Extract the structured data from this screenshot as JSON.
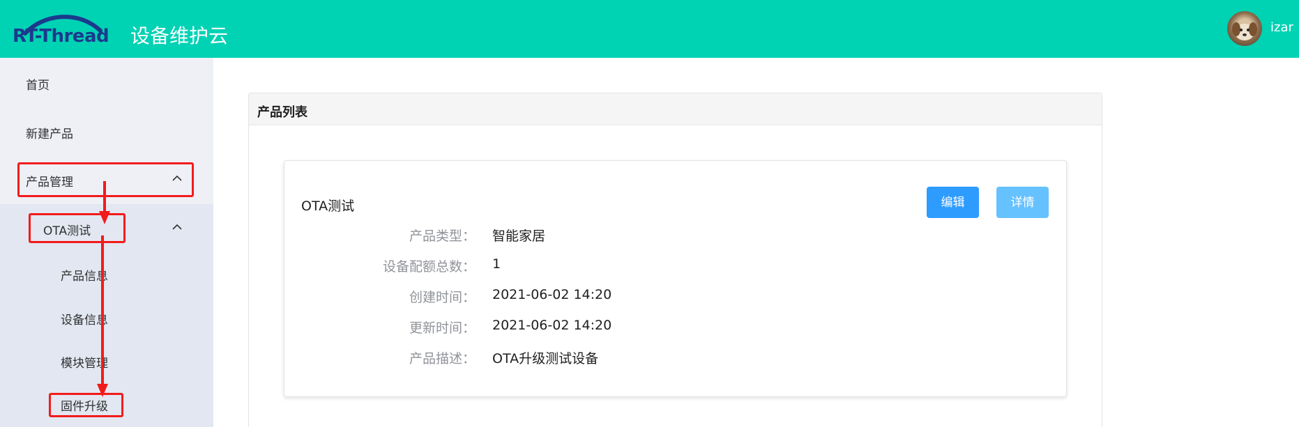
{
  "header": {
    "logo_text": "RT-Thread",
    "app_title": "设备维护云",
    "username": "izar"
  },
  "sidebar": {
    "items": [
      {
        "label": "首页"
      },
      {
        "label": "新建产品"
      },
      {
        "label": "产品管理",
        "expanded": true
      },
      {
        "label": "OTA测试",
        "expanded": true
      },
      {
        "label": "产品信息"
      },
      {
        "label": "设备信息"
      },
      {
        "label": "模块管理"
      },
      {
        "label": "固件升级"
      }
    ]
  },
  "panel": {
    "title": "产品列表"
  },
  "card": {
    "name": "OTA测试",
    "edit_label": "编辑",
    "detail_label": "详情",
    "rows": [
      {
        "label": "产品类型：",
        "value": "智能家居"
      },
      {
        "label": "设备配额总数：",
        "value": "1"
      },
      {
        "label": "创建时间：",
        "value": "2021-06-02 14:20"
      },
      {
        "label": "更新时间：",
        "value": "2021-06-02 14:20"
      },
      {
        "label": "产品描述：",
        "value": "OTA升级测试设备"
      }
    ]
  },
  "colors": {
    "header_bg": "#00d2b4",
    "logo": "#1b3a8c",
    "annotation": "#f21b1b",
    "edit_button": "#2e9cff",
    "detail_button": "#66c1ff",
    "sidebar_bg": "#eef0f6",
    "submenu_bg": "#e3e7f1"
  },
  "icons": {
    "chevron": "chevron-up-icon",
    "avatar": "dog-avatar"
  }
}
